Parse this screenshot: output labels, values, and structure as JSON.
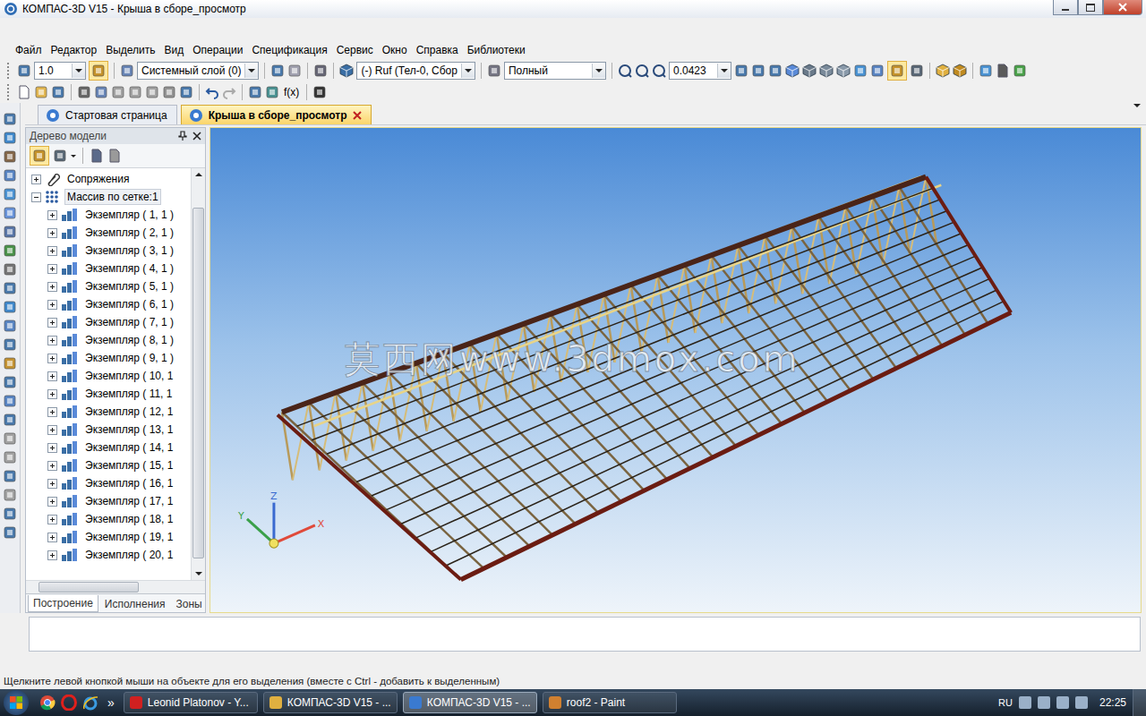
{
  "window": {
    "title": "КОМПАС-3D V15 - Крыша в сборе_просмотр"
  },
  "menu": [
    "Файл",
    "Редактор",
    "Выделить",
    "Вид",
    "Операции",
    "Спецификация",
    "Сервис",
    "Окно",
    "Справка",
    "Библиотеки"
  ],
  "toolbar": {
    "scale": "1.0",
    "layer": "Системный слой (0)",
    "body": "(-) Ruf (Тел-0, Сбор",
    "view": "Полный",
    "zoom": "0.0423",
    "fx": "f(x)"
  },
  "doc_tabs": [
    {
      "label": "Стартовая страница",
      "selected": false,
      "closable": false
    },
    {
      "label": "Крыша в сборе_просмотр",
      "selected": true,
      "closable": true
    }
  ],
  "tree_panel": {
    "title": "Дерево модели",
    "items": [
      {
        "label": "Сопряжения",
        "depth": 0,
        "expanded": false,
        "selected": false,
        "kind": "mates"
      },
      {
        "label": "Массив по сетке:1",
        "depth": 0,
        "expanded": true,
        "selected": true,
        "kind": "array"
      },
      {
        "label": "Экземпляр ( 1, 1 )",
        "depth": 1,
        "expanded": false,
        "selected": false,
        "kind": "instance"
      },
      {
        "label": "Экземпляр ( 2, 1 )",
        "depth": 1,
        "expanded": false,
        "selected": false,
        "kind": "instance"
      },
      {
        "label": "Экземпляр ( 3, 1 )",
        "depth": 1,
        "expanded": false,
        "selected": false,
        "kind": "instance"
      },
      {
        "label": "Экземпляр ( 4, 1 )",
        "depth": 1,
        "expanded": false,
        "selected": false,
        "kind": "instance"
      },
      {
        "label": "Экземпляр ( 5, 1 )",
        "depth": 1,
        "expanded": false,
        "selected": false,
        "kind": "instance"
      },
      {
        "label": "Экземпляр ( 6, 1 )",
        "depth": 1,
        "expanded": false,
        "selected": false,
        "kind": "instance"
      },
      {
        "label": "Экземпляр ( 7, 1 )",
        "depth": 1,
        "expanded": false,
        "selected": false,
        "kind": "instance"
      },
      {
        "label": "Экземпляр ( 8, 1 )",
        "depth": 1,
        "expanded": false,
        "selected": false,
        "kind": "instance"
      },
      {
        "label": "Экземпляр ( 9, 1 )",
        "depth": 1,
        "expanded": false,
        "selected": false,
        "kind": "instance"
      },
      {
        "label": "Экземпляр ( 10, 1",
        "depth": 1,
        "expanded": false,
        "selected": false,
        "kind": "instance"
      },
      {
        "label": "Экземпляр ( 11, 1",
        "depth": 1,
        "expanded": false,
        "selected": false,
        "kind": "instance"
      },
      {
        "label": "Экземпляр ( 12, 1",
        "depth": 1,
        "expanded": false,
        "selected": false,
        "kind": "instance"
      },
      {
        "label": "Экземпляр ( 13, 1",
        "depth": 1,
        "expanded": false,
        "selected": false,
        "kind": "instance"
      },
      {
        "label": "Экземпляр ( 14, 1",
        "depth": 1,
        "expanded": false,
        "selected": false,
        "kind": "instance"
      },
      {
        "label": "Экземпляр ( 15, 1",
        "depth": 1,
        "expanded": false,
        "selected": false,
        "kind": "instance"
      },
      {
        "label": "Экземпляр ( 16, 1",
        "depth": 1,
        "expanded": false,
        "selected": false,
        "kind": "instance"
      },
      {
        "label": "Экземпляр ( 17, 1",
        "depth": 1,
        "expanded": false,
        "selected": false,
        "kind": "instance"
      },
      {
        "label": "Экземпляр ( 18, 1",
        "depth": 1,
        "expanded": false,
        "selected": false,
        "kind": "instance"
      },
      {
        "label": "Экземпляр ( 19, 1",
        "depth": 1,
        "expanded": false,
        "selected": false,
        "kind": "instance"
      },
      {
        "label": "Экземпляр ( 20, 1",
        "depth": 1,
        "expanded": false,
        "selected": false,
        "kind": "instance"
      }
    ],
    "tabs": [
      {
        "label": "Построение",
        "selected": true
      },
      {
        "label": "Исполнения",
        "selected": false
      },
      {
        "label": "Зоны",
        "selected": false
      }
    ]
  },
  "viewport": {
    "watermark": "莫西网www.3dmox.com",
    "axes": [
      {
        "label": "X",
        "color": "#e04a3a"
      },
      {
        "label": "Y",
        "color": "#3aa04a"
      },
      {
        "label": "Z",
        "color": "#3a6ad0"
      }
    ]
  },
  "status_bar": "Щелкните левой кнопкой мыши на объекте для его выделения (вместе с Ctrl - добавить к выделенным)",
  "taskbar": {
    "more": "»",
    "items": [
      {
        "label": "Leonid Platonov - Y...",
        "selected": false,
        "color": "#d02020"
      },
      {
        "label": "КОМПАС-3D V15 - ...",
        "selected": false,
        "color": "#e0b040"
      },
      {
        "label": "КОМПАС-3D V15 - ...",
        "selected": true,
        "color": "#3a7ad0"
      },
      {
        "label": "roof2 - Paint",
        "selected": false,
        "color": "#d08030"
      }
    ],
    "language": "RU",
    "time": "22:25"
  }
}
